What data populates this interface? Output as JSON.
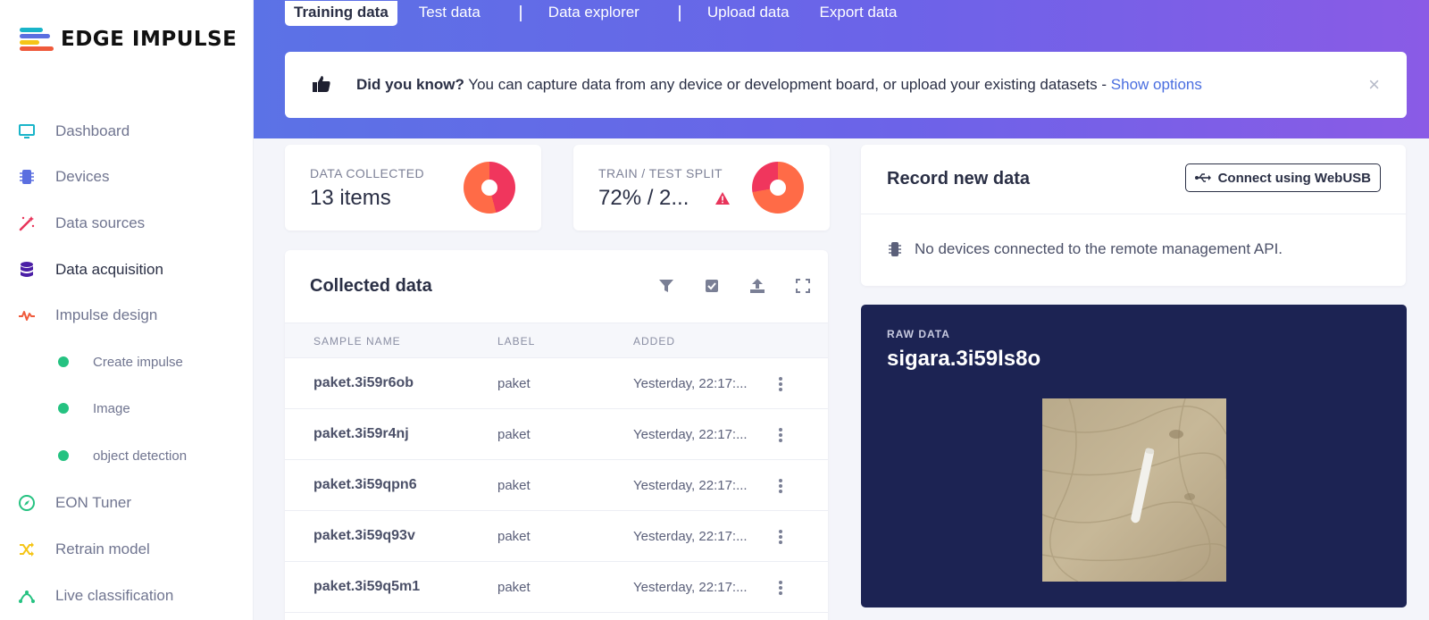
{
  "brand": {
    "name": "EDGE IMPULSE"
  },
  "sidebar": {
    "items": [
      {
        "label": "Dashboard",
        "icon": "monitor-icon",
        "color": "#19b4c9"
      },
      {
        "label": "Devices",
        "icon": "chip-icon",
        "color": "#5b6fe0"
      },
      {
        "label": "Data sources",
        "icon": "magic-wand-icon",
        "color": "#e8345a"
      },
      {
        "label": "Data acquisition",
        "icon": "database-icon",
        "color": "#4b1fa6"
      },
      {
        "label": "Impulse design",
        "icon": "pulse-icon",
        "color": "#ef5a3b"
      },
      {
        "label": "Create impulse",
        "icon": "dot-icon",
        "color": "#25c281"
      },
      {
        "label": "Image",
        "icon": "dot-icon",
        "color": "#25c281"
      },
      {
        "label": "object detection",
        "icon": "dot-icon",
        "color": "#25c281"
      },
      {
        "label": "EON Tuner",
        "icon": "compass-icon",
        "color": "#25c281"
      },
      {
        "label": "Retrain model",
        "icon": "shuffle-icon",
        "color": "#f5c518"
      },
      {
        "label": "Live classification",
        "icon": "nodes-icon",
        "color": "#25c281"
      }
    ]
  },
  "tabs": [
    "Training data",
    "Test data",
    "Data explorer",
    "Upload data",
    "Export data"
  ],
  "notice": {
    "bold": "Did you know?",
    "text": " You can capture data from any device or development board, or upload your existing datasets - ",
    "link": "Show options",
    "close": "×"
  },
  "stats": {
    "collected": {
      "title": "DATA COLLECTED",
      "value": "13 items"
    },
    "split": {
      "title": "TRAIN / TEST SPLIT",
      "value": "72% / 2..."
    }
  },
  "collected": {
    "title": "Collected data",
    "columns": [
      "SAMPLE NAME",
      "LABEL",
      "ADDED"
    ],
    "rows": [
      {
        "name": "paket.3i59r6ob",
        "label": "paket",
        "added": "Yesterday, 22:17:..."
      },
      {
        "name": "paket.3i59r4nj",
        "label": "paket",
        "added": "Yesterday, 22:17:..."
      },
      {
        "name": "paket.3i59qpn6",
        "label": "paket",
        "added": "Yesterday, 22:17:..."
      },
      {
        "name": "paket.3i59q93v",
        "label": "paket",
        "added": "Yesterday, 22:17:..."
      },
      {
        "name": "paket.3i59q5m1",
        "label": "paket",
        "added": "Yesterday, 22:17:..."
      }
    ]
  },
  "record": {
    "title": "Record new data",
    "button": "Connect using WebUSB",
    "message": "No devices connected to the remote management API."
  },
  "raw": {
    "label": "RAW DATA",
    "name": "sigara.3i59ls8o"
  },
  "colors": {
    "accent": "#4a6ee0",
    "dark_panel": "#1c2353",
    "donut_a": "#ff6b47",
    "donut_b": "#f0365d"
  }
}
